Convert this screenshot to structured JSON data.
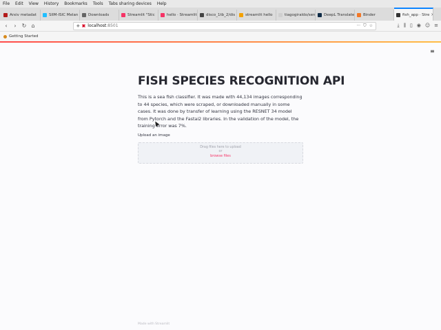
{
  "menubar": {
    "items": [
      "File",
      "Edit",
      "View",
      "History",
      "Bookmarks",
      "Tools",
      "Tabs sharing devices",
      "Help"
    ]
  },
  "tabs": [
    {
      "label": "Arxiv metadat",
      "color": "#b31b1b"
    },
    {
      "label": "SIIM-ISIC Melan",
      "color": "#20beff"
    },
    {
      "label": "Downloads",
      "color": "#666666"
    },
    {
      "label": "Streamlit \"Stic",
      "color": "#f63366"
    },
    {
      "label": "hello · Streamlit",
      "color": "#f63366"
    },
    {
      "label": "disco_1tb_2/dis",
      "color": "#444444"
    },
    {
      "label": "streamlit hello",
      "color": "#f4a100"
    },
    {
      "label": "tiagogiraldo/sen",
      "color": "#cfcfcf"
    },
    {
      "label": "DeepL Translate",
      "color": "#0f2b46"
    },
    {
      "label": "Binder",
      "color": "#f37726"
    },
    {
      "label": "fish_app · Stre",
      "color": "#333333",
      "active": true
    }
  ],
  "navbar": {
    "url_host": "localhost",
    "url_port": ":8501"
  },
  "bookmarks": {
    "item": "Getting Started"
  },
  "page": {
    "title": "FISH SPECIES RECOGNITION API",
    "description": "This is a sea fish classifier. It was made with 44,134 images corresponding to 44 species, which were scraped, or downloaded manually in some cases. It was done by transfer of learning using the RESNET 34 model from Pytorch and the Fastai2 libraries. In the validation of the model, the training error was 7%.",
    "upload_label": "Upload an image",
    "dropzone_text": "Drag files here to upload",
    "dropzone_or": "or",
    "browse_label": "browse files",
    "footer": "Made with Streamlit"
  }
}
